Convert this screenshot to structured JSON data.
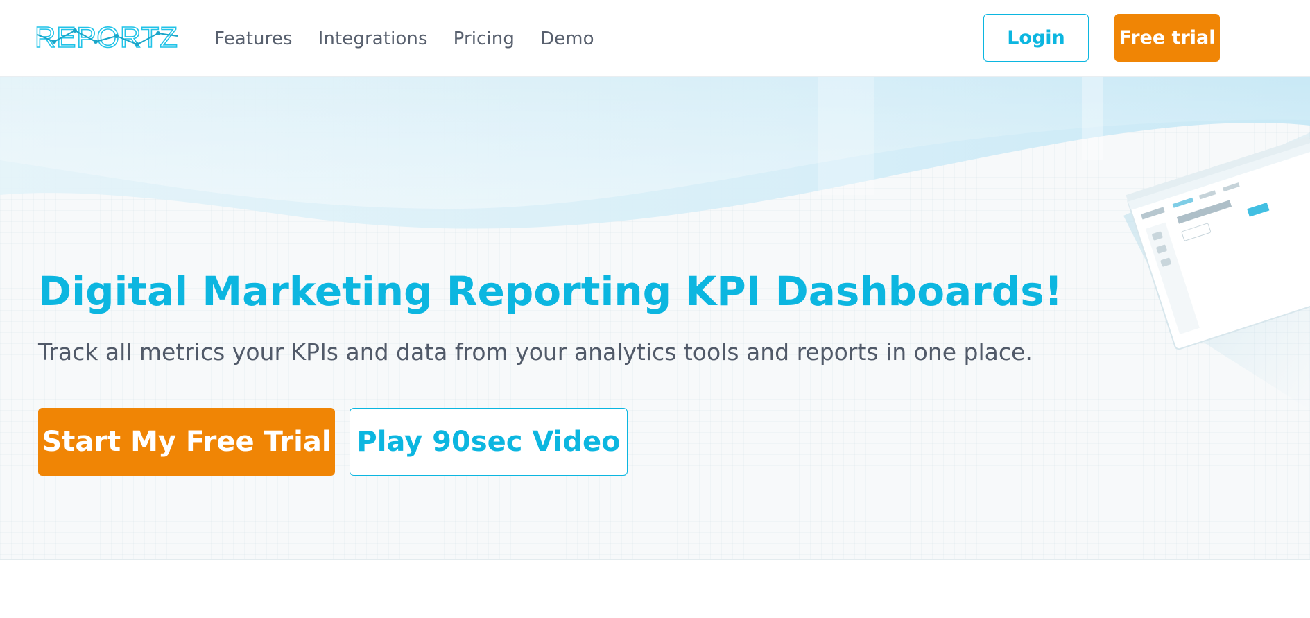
{
  "brand": {
    "logo_text": "REPORTZ",
    "accent_color": "#0cb6e0",
    "cta_color": "#f08505"
  },
  "nav": {
    "items": [
      {
        "label": "Features"
      },
      {
        "label": "Integrations"
      },
      {
        "label": "Pricing"
      },
      {
        "label": "Demo"
      }
    ],
    "login_label": "Login",
    "free_trial_label": "Free trial"
  },
  "hero": {
    "headline": "Digital Marketing Reporting KPI Dashboards!",
    "subheadline": "Track all metrics your KPIs and data from your analytics tools and reports in one place.",
    "primary_cta": "Start My Free Trial",
    "secondary_cta": "Play 90sec Video"
  }
}
